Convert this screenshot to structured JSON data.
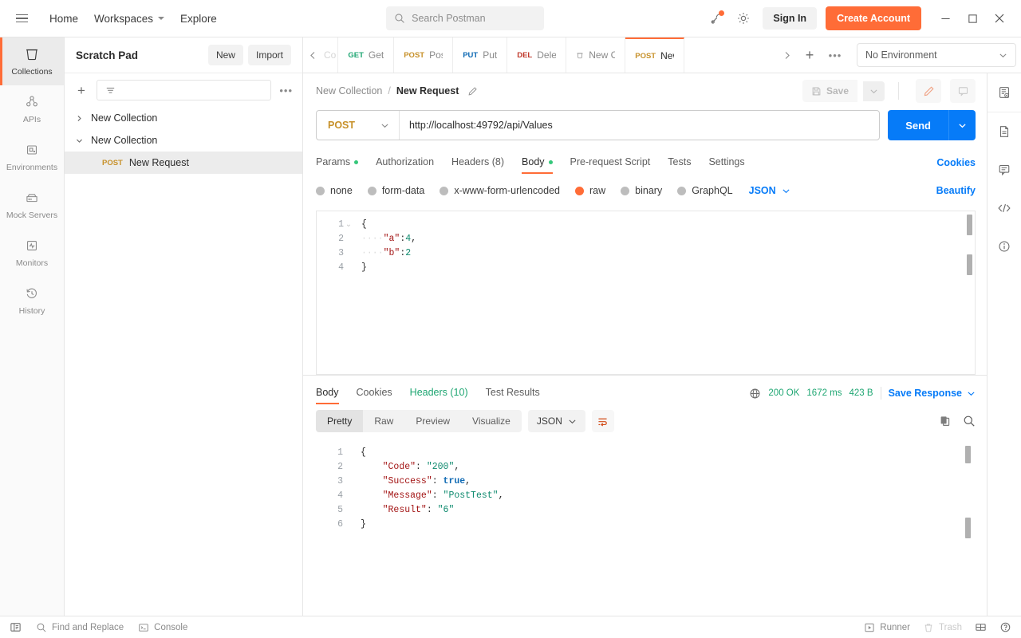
{
  "header": {
    "menu_icon": "hamburger-icon",
    "nav": [
      {
        "label": "Home",
        "caret": false
      },
      {
        "label": "Workspaces",
        "caret": true
      },
      {
        "label": "Explore",
        "caret": false
      }
    ],
    "search_placeholder": "Search Postman",
    "search_icon": "search-icon",
    "satellite_icon": "satellite-icon",
    "settings_icon": "gear-icon",
    "sign_in_label": "Sign In",
    "create_account_label": "Create Account",
    "window_minimize": "minimize-icon",
    "window_maximize": "maximize-icon",
    "window_close": "close-icon",
    "accent_color": "#ff6c37"
  },
  "sidebar": {
    "title": "Scratch Pad",
    "new_label": "New",
    "import_label": "Import",
    "add_icon": "plus-icon",
    "filter_icon": "filter-icon",
    "more_icon": "more-horizontal-icon",
    "rail": [
      {
        "label": "Collections",
        "icon": "collections-icon",
        "active": true
      },
      {
        "label": "APIs",
        "icon": "apis-icon",
        "active": false
      },
      {
        "label": "Environments",
        "icon": "environments-icon",
        "active": false
      },
      {
        "label": "Mock Servers",
        "icon": "mock-servers-icon",
        "active": false
      },
      {
        "label": "Monitors",
        "icon": "monitors-icon",
        "active": false
      },
      {
        "label": "History",
        "icon": "history-icon",
        "active": false
      }
    ],
    "tree": [
      {
        "label": "New Collection",
        "expanded": false,
        "selected": false
      },
      {
        "label": "New Collection",
        "expanded": true,
        "selected": false
      }
    ],
    "request": {
      "method": "POST",
      "label": "New Request",
      "selected": true
    }
  },
  "tabstrip": {
    "prev_icon": "chevron-left-icon",
    "next_icon": "chevron-right-icon",
    "add_icon": "plus-icon",
    "more_icon": "more-horizontal-icon",
    "tabs": [
      {
        "method": "",
        "label": "Co",
        "kind": "partial",
        "active": false
      },
      {
        "method": "GET",
        "label": "Get",
        "kind": "get",
        "active": false
      },
      {
        "method": "POST",
        "label": "Post",
        "kind": "post",
        "active": false
      },
      {
        "method": "PUT",
        "label": "Put",
        "kind": "put",
        "active": false
      },
      {
        "method": "DEL",
        "label": "Delete",
        "kind": "del",
        "active": false
      },
      {
        "method": "COLLECTION",
        "label": "New Co",
        "kind": "collection",
        "active": false
      },
      {
        "method": "POST",
        "label": "New R",
        "kind": "post",
        "active": true
      }
    ],
    "environment": "No Environment",
    "env_quick_look_icon": "environment-quick-look-icon"
  },
  "right_rail": [
    {
      "icon": "environment-quick-look-icon"
    },
    {
      "icon": "documentation-icon"
    },
    {
      "icon": "comments-icon"
    },
    {
      "icon": "code-icon"
    },
    {
      "icon": "info-icon"
    }
  ],
  "request": {
    "breadcrumb_collection": "New Collection",
    "breadcrumb_separator": "/",
    "breadcrumb_request": "New Request",
    "edit_icon": "pencil-icon",
    "save_label": "Save",
    "save_icon": "save-icon",
    "save_caret_icon": "chevron-down-icon",
    "edit_pencil_icon": "pencil-icon",
    "comment_icon": "comment-icon",
    "method": "POST",
    "method_caret_icon": "chevron-down-icon",
    "url": "http://localhost:49792/api/Values",
    "send_label": "Send",
    "send_caret_icon": "chevron-down-icon",
    "send_color": "#067bf8",
    "tabs": [
      {
        "label": "Params",
        "dot": true,
        "active": false
      },
      {
        "label": "Authorization",
        "dot": false,
        "active": false
      },
      {
        "label": "Headers (8)",
        "dot": false,
        "active": false
      },
      {
        "label": "Body",
        "dot": true,
        "active": true
      },
      {
        "label": "Pre-request Script",
        "dot": false,
        "active": false
      },
      {
        "label": "Tests",
        "dot": false,
        "active": false
      },
      {
        "label": "Settings",
        "dot": false,
        "active": false
      }
    ],
    "cookies_link": "Cookies",
    "body_types": [
      {
        "label": "none",
        "selected": false
      },
      {
        "label": "form-data",
        "selected": false
      },
      {
        "label": "x-www-form-urlencoded",
        "selected": false
      },
      {
        "label": "raw",
        "selected": true
      },
      {
        "label": "binary",
        "selected": false
      },
      {
        "label": "GraphQL",
        "selected": false
      }
    ],
    "raw_format": "JSON",
    "raw_format_caret_icon": "chevron-down-icon",
    "beautify_label": "Beautify",
    "body_lines": [
      {
        "n": "1",
        "text": "{"
      },
      {
        "n": "2",
        "text": "    \"a\":4,"
      },
      {
        "n": "3",
        "text": "    \"b\":2"
      },
      {
        "n": "4",
        "text": "}"
      }
    ]
  },
  "response": {
    "tabs": [
      {
        "label": "Body",
        "active": true
      },
      {
        "label": "Cookies",
        "active": false
      },
      {
        "label": "Headers (10)",
        "active": false
      },
      {
        "label": "Test Results",
        "active": false
      }
    ],
    "globe_icon": "globe-icon",
    "status": "200 OK",
    "time": "1672 ms",
    "size": "423 B",
    "save_response_label": "Save Response",
    "save_response_caret_icon": "chevron-down-icon",
    "view_modes": [
      {
        "label": "Pretty",
        "active": true
      },
      {
        "label": "Raw",
        "active": false
      },
      {
        "label": "Preview",
        "active": false
      },
      {
        "label": "Visualize",
        "active": false
      }
    ],
    "format": "JSON",
    "format_caret_icon": "chevron-down-icon",
    "wrap_icon": "word-wrap-icon",
    "copy_icon": "copy-icon",
    "search_icon": "search-icon",
    "body_lines": [
      {
        "n": "1",
        "text": "{"
      },
      {
        "n": "2",
        "key": "\"Code\"",
        "val": "\"200\"",
        "type": "string",
        "comma": ","
      },
      {
        "n": "3",
        "key": "\"Success\"",
        "val": "true",
        "type": "bool",
        "comma": ","
      },
      {
        "n": "4",
        "key": "\"Message\"",
        "val": "\"PostTest\"",
        "type": "string",
        "comma": ","
      },
      {
        "n": "5",
        "key": "\"Result\"",
        "val": "\"6\"",
        "type": "string",
        "comma": ""
      },
      {
        "n": "6",
        "text": "}"
      }
    ]
  },
  "statusbar": {
    "sidebar_toggle_icon": "sidebar-toggle-icon",
    "find_replace_label": "Find and Replace",
    "find_replace_icon": "search-icon",
    "console_label": "Console",
    "console_icon": "console-icon",
    "runner_label": "Runner",
    "runner_icon": "runner-icon",
    "trash_label": "Trash",
    "trash_icon": "trash-icon",
    "layout_icon": "two-pane-icon",
    "help_icon": "help-icon"
  }
}
